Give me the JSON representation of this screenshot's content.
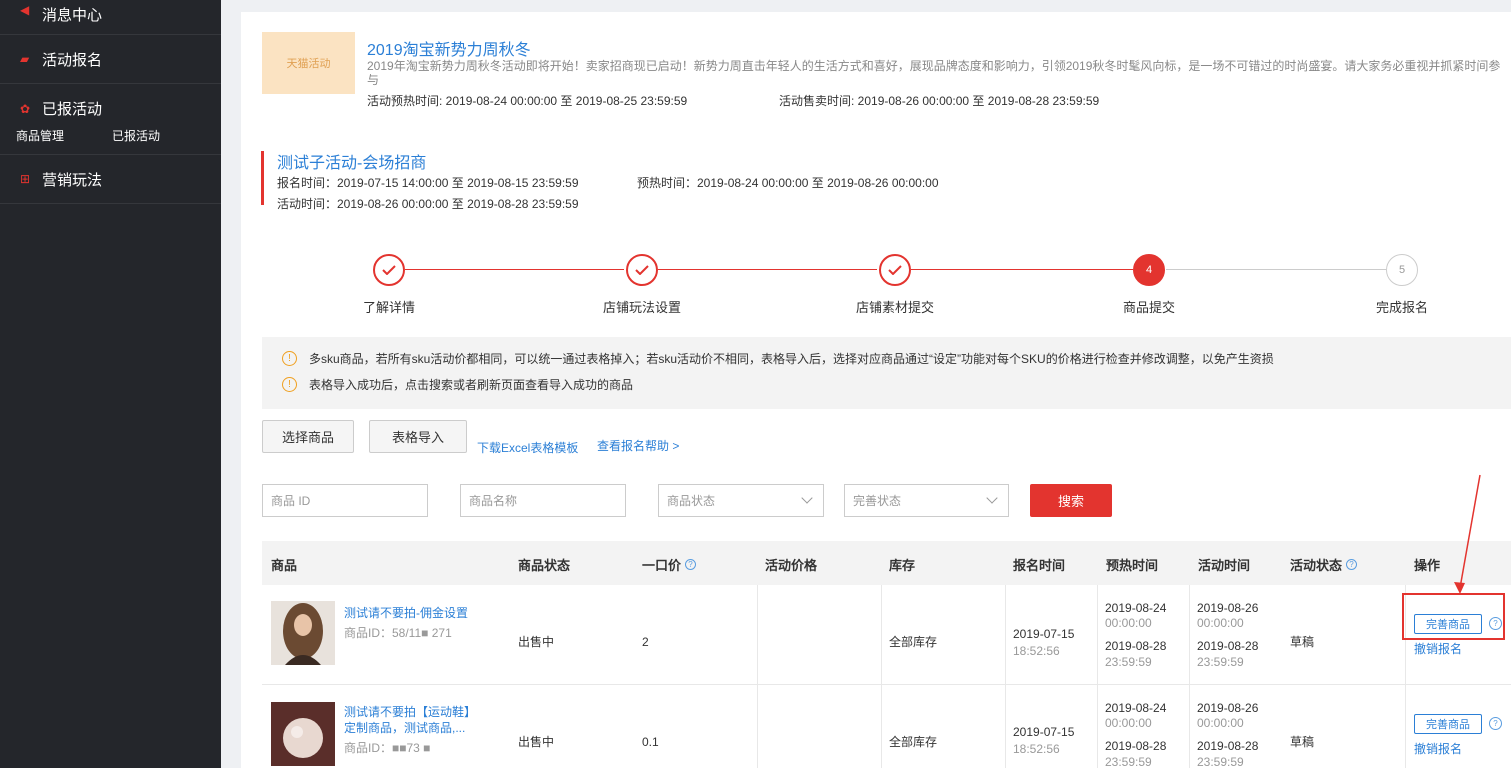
{
  "sidebar": {
    "items": [
      {
        "label": "消息中心",
        "icon": "speaker-icon"
      },
      {
        "label": "活动报名",
        "icon": "signup-icon"
      },
      {
        "label": "已报活动",
        "icon": "gear-icon"
      },
      {
        "label": "营销玩法",
        "icon": "gift-icon"
      }
    ],
    "sub_items": [
      "商品管理",
      "已报活动"
    ]
  },
  "activity": {
    "badge": "天猫活动",
    "title": "2019淘宝新势力周秋冬",
    "desc": "2019年淘宝新势力周秋冬活动即将开始！卖家招商现已启动！新势力周直击年轻人的生活方式和喜好，展现品牌态度和影响力，引领2019秋冬时髦风向标，是一场不可错过的时尚盛宴。请大家务必重视并抓紧时间参与",
    "preheat": "活动预热时间: 2019-08-24 00:00:00 至 2019-08-25 23:59:59",
    "sale": "活动售卖时间: 2019-08-26 00:00:00 至 2019-08-28 23:59:59"
  },
  "sub_activity": {
    "title": "测试子活动-会场招商",
    "signup": "报名时间：2019-07-15 14:00:00 至 2019-08-15 23:59:59",
    "preheat": "预热时间：2019-08-24 00:00:00 至 2019-08-26 00:00:00",
    "active": "活动时间：2019-08-26 00:00:00 至 2019-08-28 23:59:59"
  },
  "steps": [
    {
      "label": "了解详情",
      "state": "done"
    },
    {
      "label": "店铺玩法设置",
      "state": "done"
    },
    {
      "label": "店铺素材提交",
      "state": "done"
    },
    {
      "label": "商品提交",
      "state": "active",
      "num": "4"
    },
    {
      "label": "完成报名",
      "state": "todo",
      "num": "5"
    }
  ],
  "notices": [
    "多sku商品，若所有sku活动价都相同，可以统一通过表格掉入；若sku活动价不相同，表格导入后，选择对应商品通过“设定”功能对每个SKU的价格进行检查并修改调整，以免产生资损",
    "表格导入成功后，点击搜索或者刷新页面查看导入成功的商品"
  ],
  "toolbar": {
    "select_label": "选择商品",
    "import_label": "表格导入",
    "download_link": "下载Excel表格模板",
    "help_link": "查看报名帮助 >"
  },
  "filters": {
    "id_placeholder": "商品 ID",
    "name_placeholder": "商品名称",
    "status_placeholder": "商品状态",
    "complete_placeholder": "完善状态",
    "search_label": "搜索"
  },
  "table": {
    "headers": [
      "商品",
      "商品状态",
      "一口价",
      "活动价格",
      "库存",
      "报名时间",
      "预热时间",
      "活动时间",
      "活动状态",
      "操作"
    ],
    "rows": [
      {
        "name_line1": "测试请不要拍-佣金设置",
        "name_line2": "",
        "id": "商品ID：58/11■ 271",
        "status": "出售中",
        "price": "2",
        "act_price": "",
        "stock": "全部库存",
        "signup_date": "2019-07-15",
        "signup_time": "18:52:56",
        "pre_start_date": "2019-08-24",
        "pre_start_time": "00:00:00",
        "pre_end_date": "2019-08-28",
        "pre_end_time": "23:59:59",
        "act_start_date": "2019-08-26",
        "act_start_time": "00:00:00",
        "act_end_date": "2019-08-28",
        "act_end_time": "23:59:59",
        "act_status": "草稿",
        "op_button": "完善商品",
        "op_link": "撤销报名"
      },
      {
        "name_line1": "测试请不要拍【运动鞋】",
        "name_line2": "定制商品，测试商品,...",
        "id": "商品ID：■■73 ■",
        "status": "出售中",
        "price": "0.1",
        "act_price": "",
        "stock": "全部库存",
        "signup_date": "2019-07-15",
        "signup_time": "18:52:56",
        "pre_start_date": "2019-08-24",
        "pre_start_time": "00:00:00",
        "pre_end_date": "2019-08-28",
        "pre_end_time": "23:59:59",
        "act_start_date": "2019-08-26",
        "act_start_time": "00:00:00",
        "act_end_date": "2019-08-28",
        "act_end_time": "23:59:59",
        "act_status": "草稿",
        "op_button": "完善商品",
        "op_link": "撤销报名"
      }
    ]
  },
  "colors": {
    "accent": "#e3342f",
    "link": "#2b7fd6",
    "sidebar_bg": "#24262b"
  }
}
